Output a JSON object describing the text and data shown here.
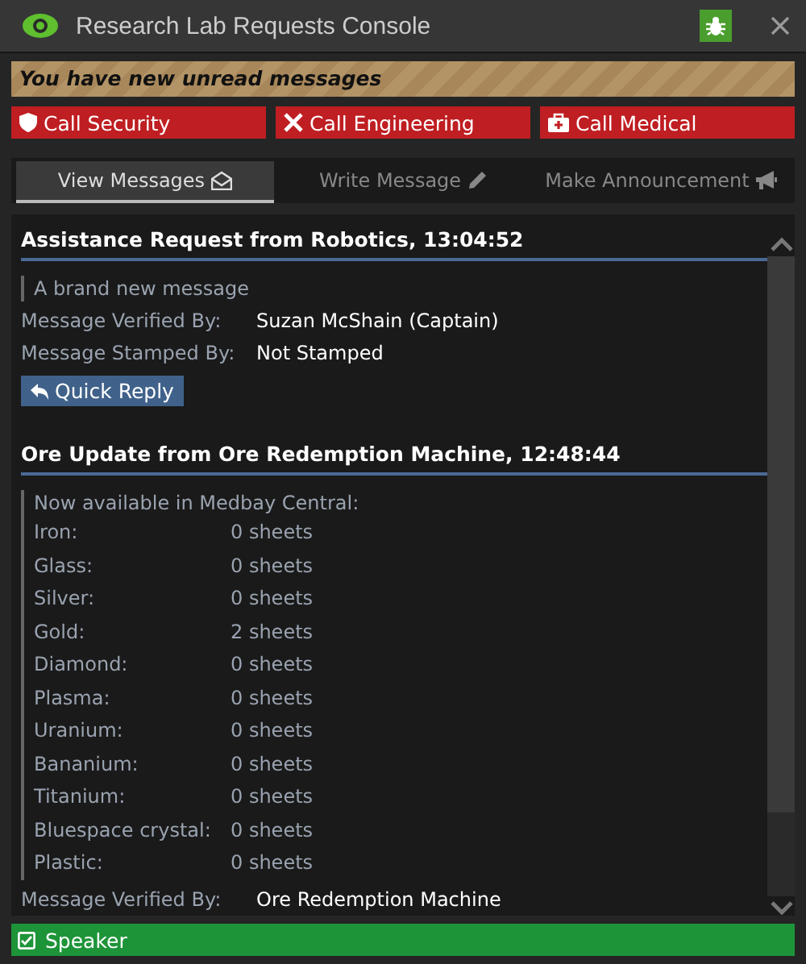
{
  "window": {
    "title": "Research Lab Requests Console"
  },
  "notice": "You have new unread messages",
  "call_buttons": [
    {
      "kind": "security",
      "label": "Call Security"
    },
    {
      "kind": "engineering",
      "label": "Call Engineering"
    },
    {
      "kind": "medical",
      "label": "Call Medical"
    }
  ],
  "tabs": [
    {
      "kind": "view",
      "label": "View Messages",
      "selected": true
    },
    {
      "kind": "write",
      "label": "Write Message",
      "selected": false
    },
    {
      "kind": "announce",
      "label": "Make Announcement",
      "selected": false
    }
  ],
  "messages": [
    {
      "title": "Assistance Request from Robotics, 13:04:52",
      "body_lines": [
        "A brand new message"
      ],
      "fields": [
        {
          "label": "Message Verified By:",
          "value": "Suzan McShain (Captain)"
        },
        {
          "label": "Message Stamped By:",
          "value": "Not Stamped"
        }
      ],
      "reply_button": "Quick Reply"
    },
    {
      "title": "Ore Update from Ore Redemption Machine, 12:48:44",
      "body_lines": [
        "Now available in Medbay Central:"
      ],
      "table": [
        [
          "Iron:",
          "0 sheets"
        ],
        [
          "Glass:",
          "0 sheets"
        ],
        [
          "Silver:",
          "0 sheets"
        ],
        [
          "Gold:",
          "2 sheets"
        ],
        [
          "Diamond:",
          "0 sheets"
        ],
        [
          "Plasma:",
          "0 sheets"
        ],
        [
          "Uranium:",
          "0 sheets"
        ],
        [
          "Bananium:",
          "0 sheets"
        ],
        [
          "Titanium:",
          "0 sheets"
        ],
        [
          "Bluespace crystal:",
          "0 sheets"
        ],
        [
          "Plastic:",
          "0 sheets"
        ]
      ],
      "fields": [
        {
          "label": "Message Verified By:",
          "value": "Ore Redemption Machine"
        }
      ]
    }
  ],
  "speaker": {
    "label": "Speaker",
    "checked": true
  }
}
